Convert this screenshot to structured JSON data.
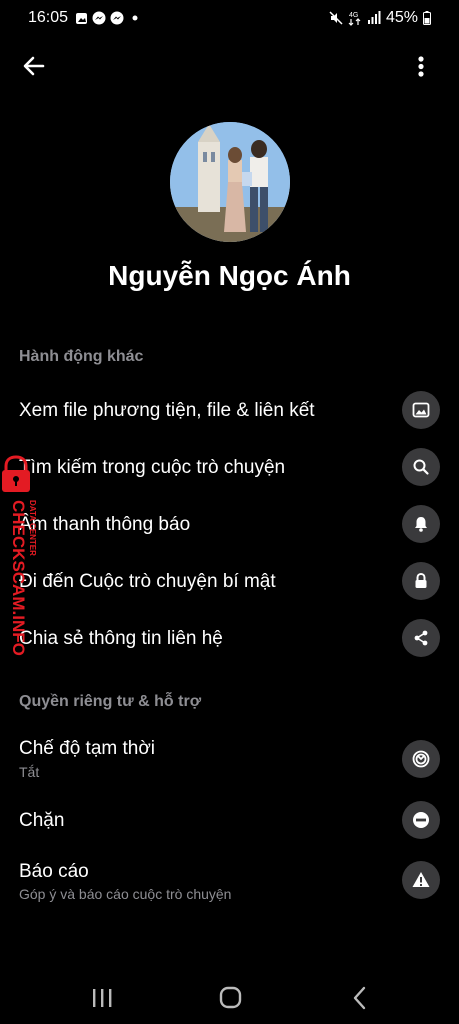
{
  "status_bar": {
    "time": "16:05",
    "battery": "45%",
    "icons_left": [
      "gallery-icon",
      "messenger-icon",
      "messenger-icon",
      "dot-icon"
    ],
    "icons_right": [
      "mute-icon",
      "4g-icon",
      "signal-icon",
      "battery-icon"
    ]
  },
  "top_bar": {
    "back_icon": "arrow-left-icon",
    "more_icon": "more-vertical-icon"
  },
  "profile": {
    "name": "Nguyễn Ngọc Ánh"
  },
  "sections": {
    "more_actions": "Hành động khác",
    "privacy_support": "Quyền riêng tư & hỗ trợ"
  },
  "actions": [
    {
      "label": "Xem file phương tiện, file & liên kết",
      "icon": "image-icon"
    },
    {
      "label": "Tìm kiếm trong cuộc trò chuyện",
      "icon": "search-icon"
    },
    {
      "label": "Âm thanh thông báo",
      "icon": "bell-icon"
    },
    {
      "label": "Đi đến Cuộc trò chuyện bí mật",
      "icon": "lock-icon"
    },
    {
      "label": "Chia sẻ thông tin liên hệ",
      "icon": "share-icon"
    }
  ],
  "privacy": [
    {
      "label": "Chế độ tạm thời",
      "sub": "Tắt",
      "icon": "vanish-mode-icon"
    },
    {
      "label": "Chặn",
      "sub": "",
      "icon": "block-icon"
    },
    {
      "label": "Báo cáo",
      "sub": "Góp ý và báo cáo cuộc trò chuyện",
      "icon": "warning-icon"
    }
  ],
  "watermark": {
    "text": "CHECKSCAM.INFO",
    "subtext": "DATA CENTER",
    "color": "#e31b23"
  },
  "nav_bar": {
    "recents_icon": "recents-icon",
    "home_icon": "home-icon",
    "back_icon": "nav-back-icon"
  }
}
